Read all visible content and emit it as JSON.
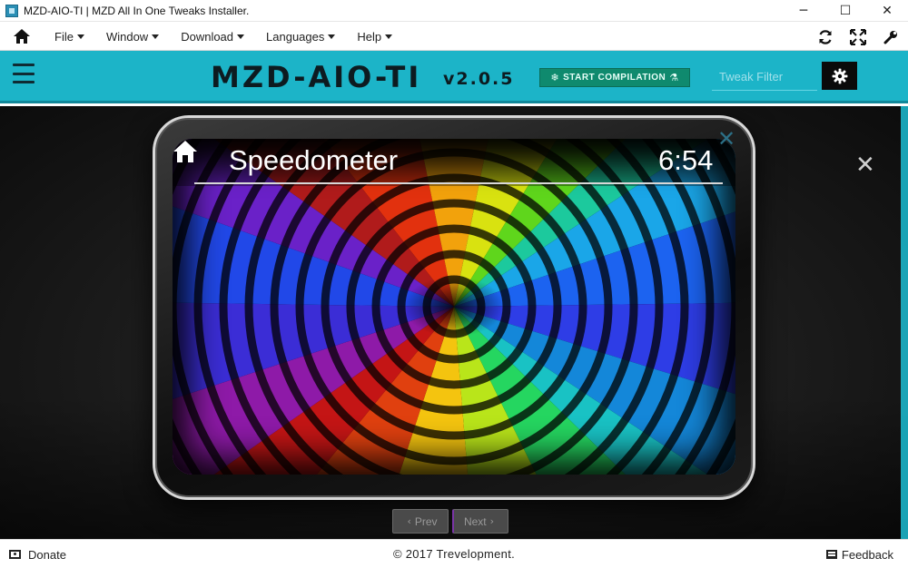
{
  "window": {
    "title": "MZD-AIO-TI | MZD All In One Tweaks Installer.",
    "controls": {
      "minimize": "─",
      "maximize": "☐",
      "close": "✕"
    }
  },
  "menubar": {
    "items": [
      {
        "label": "File"
      },
      {
        "label": "Window"
      },
      {
        "label": "Download"
      },
      {
        "label": "Languages"
      },
      {
        "label": "Help"
      }
    ],
    "right_icons": [
      "refresh-icon",
      "fullscreen-icon",
      "wrench-icon"
    ]
  },
  "header": {
    "brand": "MZD-AIO-TI",
    "version": "v2.0.5",
    "compile_label": "START COMPILATION",
    "compile_icon_left": "❄",
    "compile_icon_right": "⚗",
    "filter_placeholder": "Tweak Filter",
    "accent_color": "#1cb4c8"
  },
  "stage": {
    "screen_title": "Speedometer",
    "screen_time": "6:54",
    "close_glyph": "✕",
    "prev_label": "Prev",
    "next_label": "Next",
    "prev_chevron": "‹",
    "next_chevron": "›"
  },
  "footer": {
    "donate_label": "Donate",
    "copyright": "© 2017 Trevelopment.",
    "feedback_label": "Feedback"
  }
}
